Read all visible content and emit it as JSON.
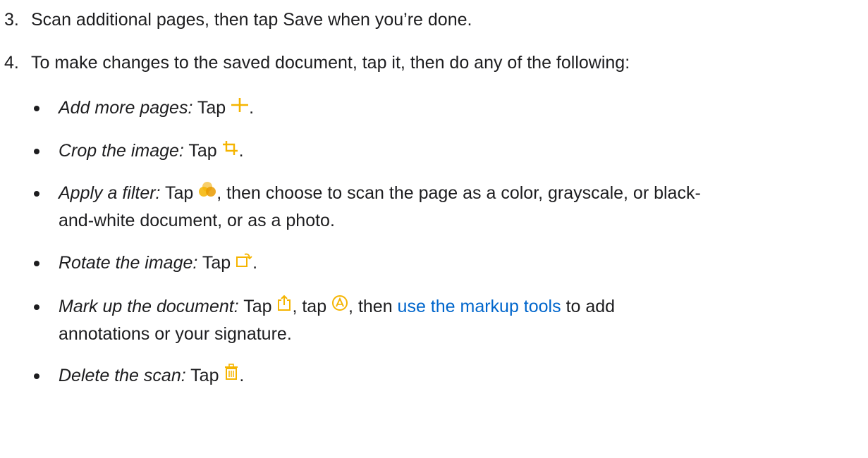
{
  "steps": [
    {
      "num": "3.",
      "text": "Scan additional pages, then tap Save when you’re done."
    },
    {
      "num": "4.",
      "text": "To make changes to the saved document, tap it, then do any of the following:"
    }
  ],
  "bullets": [
    {
      "label": "Add more pages:",
      "pre": " Tap ",
      "icon": "plus-icon",
      "post": "."
    },
    {
      "label": "Crop the image:",
      "pre": " Tap ",
      "icon": "crop-icon",
      "post": "."
    },
    {
      "label": "Apply a filter:",
      "pre": " Tap ",
      "icon": "filter-icon",
      "post1": ", then choose to scan the page as a color, grayscale, or black-",
      "post2": "and-white document, or as a photo."
    },
    {
      "label": "Rotate the image:",
      "pre": " Tap ",
      "icon": "rotate-icon",
      "post": "."
    },
    {
      "label": "Mark up the document:",
      "pre": " Tap ",
      "icon": "share-icon",
      "mid": ", tap ",
      "icon2": "markup-icon",
      "mid2": ", then ",
      "link": "use the markup tools",
      "post1": " to add",
      "post2": "annotations or your signature."
    },
    {
      "label": "Delete the scan:",
      "pre": " Tap ",
      "icon": "trash-icon",
      "post": "."
    }
  ],
  "colors": {
    "icon": "#f5b400",
    "text": "#1d1d1f",
    "link": "#0066cc"
  }
}
